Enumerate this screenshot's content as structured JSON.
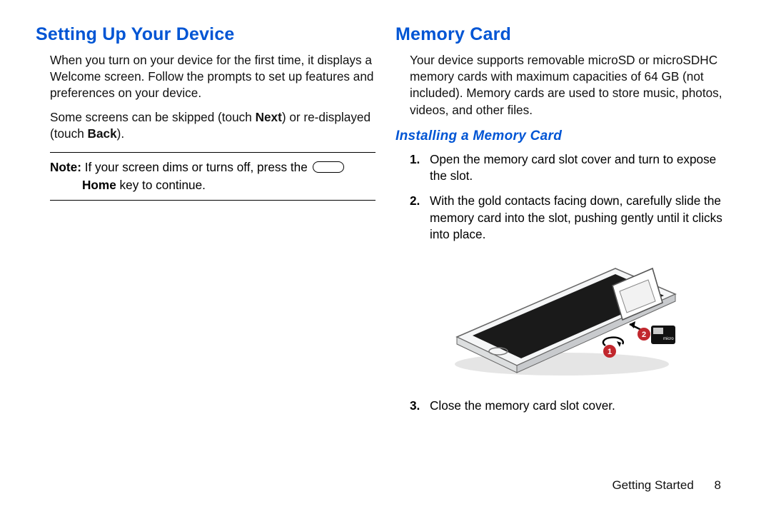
{
  "left": {
    "heading": "Setting Up Your Device",
    "p1_a": "When you turn on your device for the first time, it displays a Welcome screen. Follow the prompts to set up features and preferences on your device.",
    "p2_pre": "Some screens can be skipped (touch ",
    "p2_b1": "Next",
    "p2_mid": ") or re-displayed (touch ",
    "p2_b2": "Back",
    "p2_post": ").",
    "note_label": "Note:",
    "note_pre": " If your screen dims or turns off, press the ",
    "note_home": "Home",
    "note_post": " key to continue."
  },
  "right": {
    "heading": "Memory Card",
    "p1": "Your device supports removable microSD or microSDHC memory cards with maximum capacities of 64 GB (not included). Memory cards are used to store music, photos, videos, and other files.",
    "subheading": "Installing a Memory Card",
    "steps": [
      {
        "n": "1.",
        "t": "Open the memory card slot cover and turn to expose the slot."
      },
      {
        "n": "2.",
        "t": "With the gold contacts facing down, carefully slide the memory card into the slot, pushing gently until it clicks into place."
      },
      {
        "n": "3.",
        "t": "Close the memory card slot cover."
      }
    ],
    "callouts": {
      "c1": "1",
      "c2": "2"
    }
  },
  "footer": {
    "section": "Getting Started",
    "page": "8"
  }
}
